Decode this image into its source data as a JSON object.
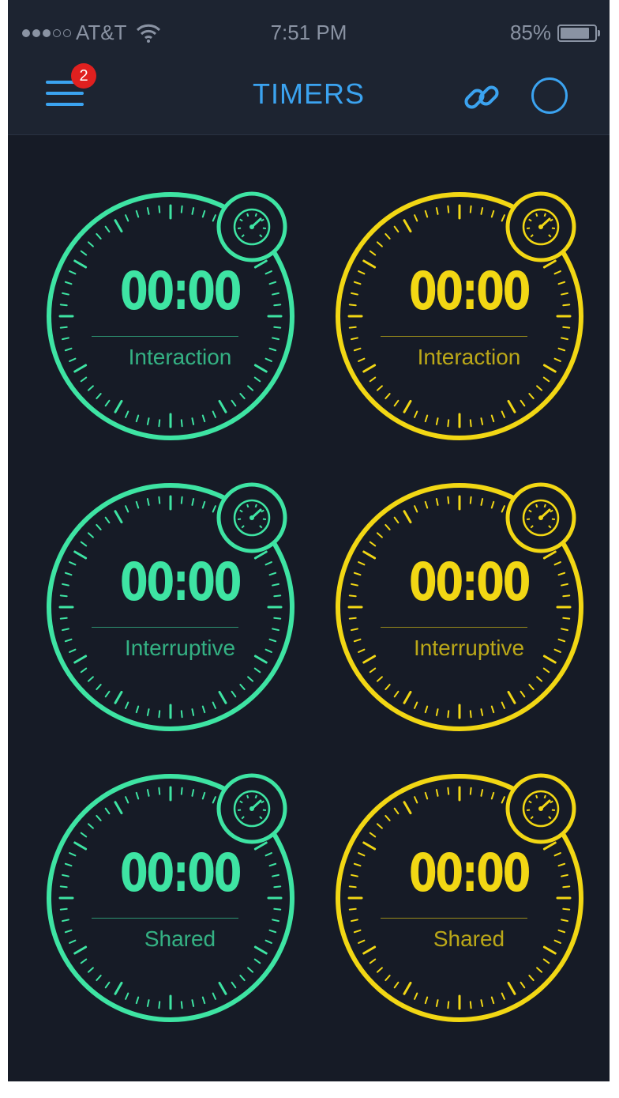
{
  "status_bar": {
    "carrier": "AT&T",
    "time": "7:51 PM",
    "battery": "85%",
    "icons": [
      "signal-dots-icon",
      "wifi-icon",
      "battery-icon"
    ]
  },
  "nav": {
    "title": "TIMERS",
    "menu_badge": "2",
    "icons": [
      "menu-icon",
      "link-icon",
      "circle-icon"
    ]
  },
  "colors": {
    "green": "#3ee4a3",
    "yellow": "#f2d714",
    "accent_blue": "#3ba3f0",
    "badge_red": "#e0201f",
    "background": "#161b26"
  },
  "timers": [
    {
      "time": "00:00",
      "label": "Interaction",
      "color": "green"
    },
    {
      "time": "00:00",
      "label": "Interaction",
      "color": "yellow"
    },
    {
      "time": "00:00",
      "label": "Interruptive",
      "color": "green"
    },
    {
      "time": "00:00",
      "label": "Interruptive",
      "color": "yellow"
    },
    {
      "time": "00:00",
      "label": "Shared",
      "color": "green"
    },
    {
      "time": "00:00",
      "label": "Shared",
      "color": "yellow"
    }
  ]
}
